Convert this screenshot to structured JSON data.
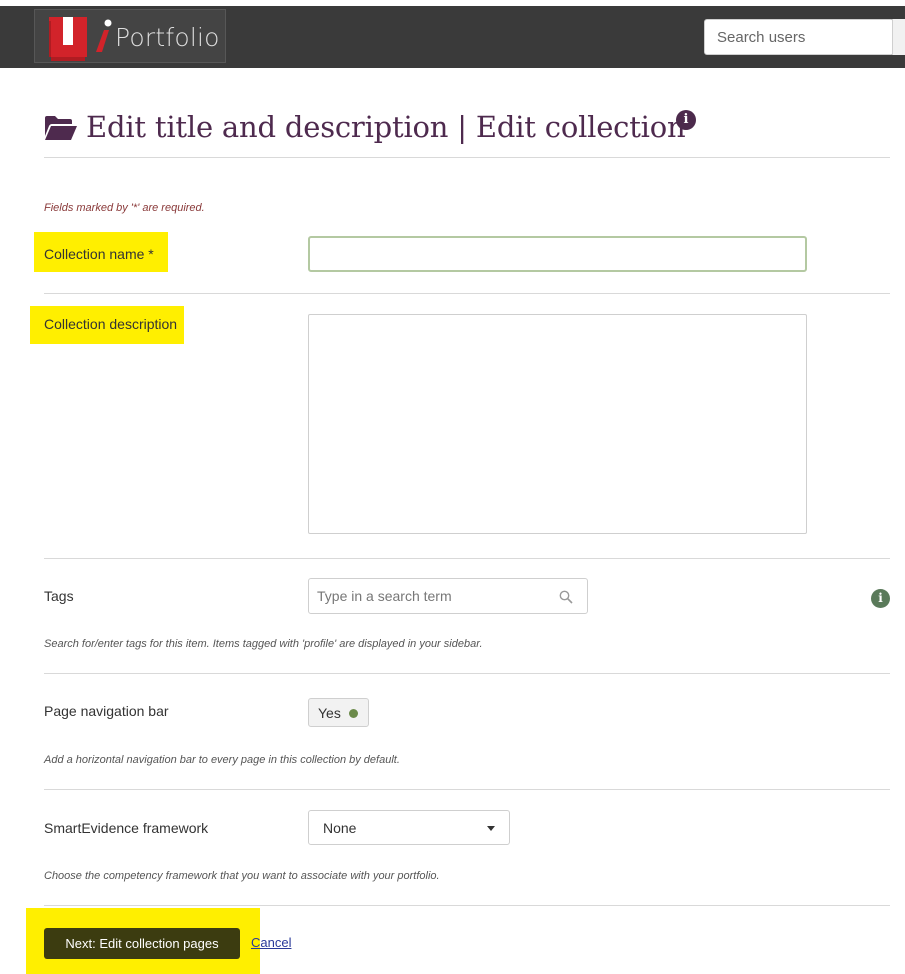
{
  "header": {
    "logo_text": "Portfolio",
    "search_placeholder": "Search users"
  },
  "page": {
    "title": "Edit title and description | Edit collection",
    "required_note": "Fields marked by '*' are required."
  },
  "form": {
    "collection_name": {
      "label": "Collection name *",
      "value": ""
    },
    "collection_description": {
      "label": "Collection description",
      "value": ""
    },
    "tags": {
      "label": "Tags",
      "placeholder": "Type in a search term",
      "description": "Search for/enter tags for this item. Items tagged with 'profile' are displayed in your sidebar."
    },
    "page_navigation_bar": {
      "label": "Page navigation bar",
      "value": "Yes",
      "description": "Add a horizontal navigation bar to every page in this collection by default."
    },
    "smartevidence": {
      "label": "SmartEvidence framework",
      "selected": "None",
      "description": "Choose the competency framework that you want to associate with your portfolio."
    }
  },
  "actions": {
    "next_label": "Next: Edit collection pages",
    "cancel_label": "Cancel"
  },
  "colors": {
    "header_bg": "#3a3a3a",
    "logo_red": "#d2232a",
    "title_color": "#4e2a4e",
    "highlight": "#ffef00",
    "button_bg": "#3c3c10",
    "toggle_dot": "#6b8a4a"
  },
  "icons": {
    "title_icon": "folder-open-icon",
    "info_icon": "info-icon",
    "search_icon": "search-icon",
    "select_icon": "caret-down-icon"
  }
}
